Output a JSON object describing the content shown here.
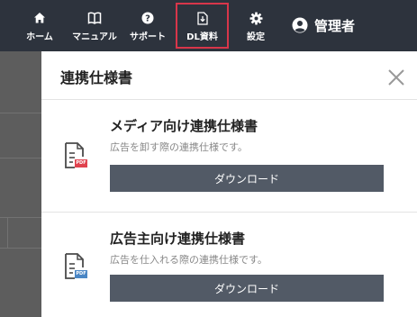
{
  "nav": {
    "items": [
      {
        "label": "ホーム",
        "icon": "home-icon"
      },
      {
        "label": "マニュアル",
        "icon": "book-icon"
      },
      {
        "label": "サポート",
        "icon": "help-icon"
      },
      {
        "label": "DL資料",
        "icon": "download-doc-icon"
      },
      {
        "label": "設定",
        "icon": "gear-icon"
      }
    ],
    "user_label": "管理者",
    "active_item": "DL資料",
    "active_border_color": "#d8364a"
  },
  "panel": {
    "title": "連携仕様書",
    "documents": [
      {
        "title": "メディア向け連携仕様書",
        "description": "広告を卸す際の連携仕様です。",
        "button_label": "ダウンロード",
        "icon": "pdf-file-icon",
        "badge": "PDF",
        "badge_color": "#e0424e"
      },
      {
        "title": "広告主向け連携仕様書",
        "description": "広告を仕入れる際の連携仕様です。",
        "button_label": "ダウンロード",
        "icon": "pdf-file-icon",
        "badge": "PDF",
        "badge_color": "#4a86c5"
      }
    ]
  }
}
